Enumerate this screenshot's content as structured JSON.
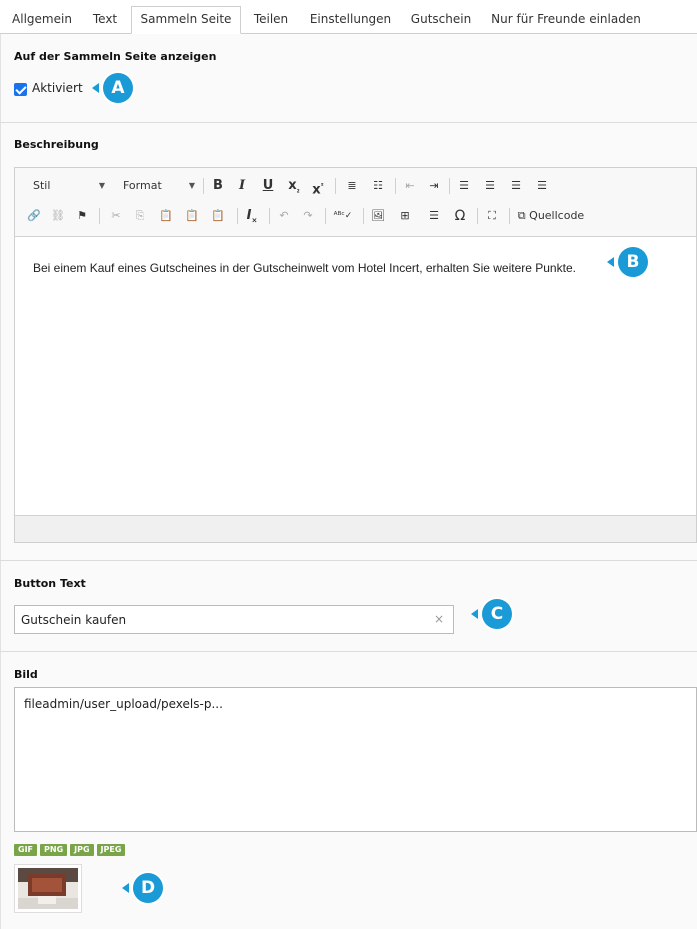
{
  "tabs": [
    {
      "label": "Allgemein"
    },
    {
      "label": "Text"
    },
    {
      "label": "Sammeln Seite",
      "active": true
    },
    {
      "label": "Teilen"
    },
    {
      "label": "Einstellungen"
    },
    {
      "label": "Gutschein"
    },
    {
      "label": "Nur für Freunde einladen"
    }
  ],
  "show_section": {
    "title": "Auf der Sammeln Seite anzeigen",
    "checkbox_label": "Aktiviert",
    "checked": true
  },
  "description": {
    "title": "Beschreibung",
    "toolbar": {
      "style_combo": "Stil",
      "format_combo": "Format",
      "source_label": "Quellcode"
    },
    "content": "Bei einem Kauf eines Gutscheines in der Gutscheinwelt vom Hotel Incert, erhalten Sie weitere Punkte."
  },
  "button_text": {
    "title": "Button Text",
    "value": "Gutschein kaufen",
    "clear_glyph": "×"
  },
  "image": {
    "title": "Bild",
    "path": "fileadmin/user_upload/pexels-p...",
    "formats": [
      "GIF",
      "PNG",
      "JPG",
      "JPEG"
    ]
  },
  "markers": [
    "A",
    "B",
    "C",
    "D"
  ],
  "colors": {
    "accent": "#1a9ad6",
    "checkbox": "#1a73e8",
    "badge": "#79a548"
  }
}
